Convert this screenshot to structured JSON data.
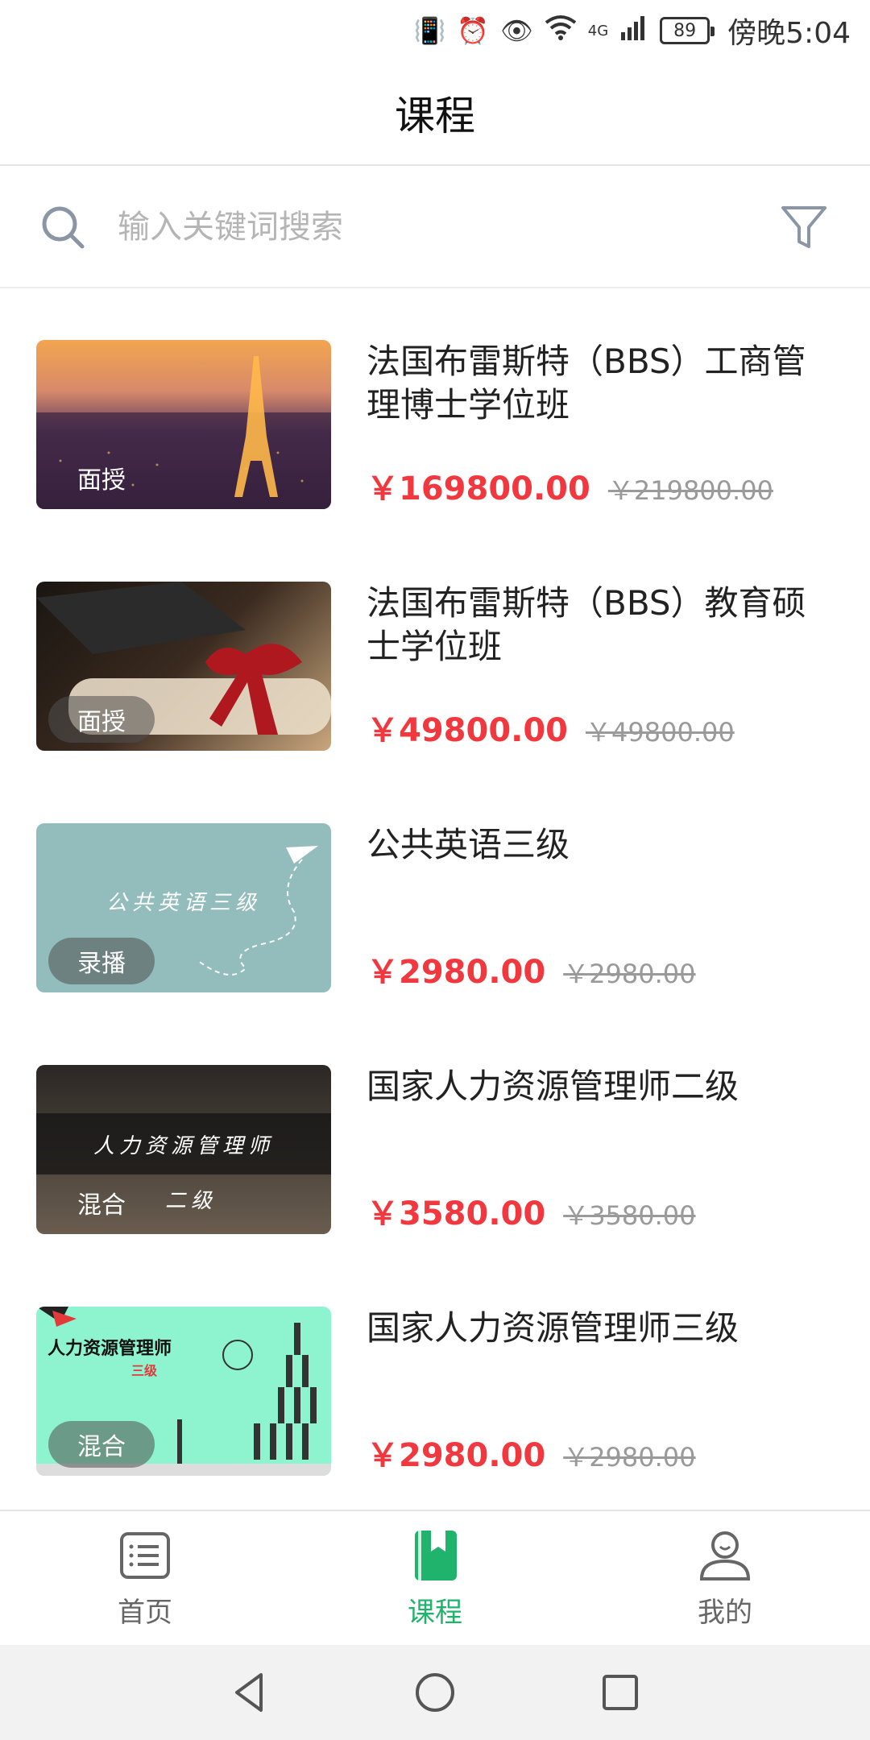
{
  "status_bar": {
    "battery": "89",
    "time": "傍晚5:04",
    "network": "4G"
  },
  "header": {
    "title": "课程"
  },
  "search": {
    "placeholder": "输入关键词搜索"
  },
  "colors": {
    "accent_green": "#1fb36b",
    "price_red": "#f2383f"
  },
  "courses": [
    {
      "title": "法国布雷斯特（BBS）工商管理博士学位班",
      "tag": "面授",
      "price": "￥169800.00",
      "original_price": "￥219800.00"
    },
    {
      "title": "法国布雷斯特（BBS）教育硕士学位班",
      "tag": "面授",
      "price": "￥49800.00",
      "original_price": "￥49800.00"
    },
    {
      "title": "公共英语三级",
      "tag": "录播",
      "price": "￥2980.00",
      "original_price": "￥2980.00",
      "thumb_text": "公共英语三级"
    },
    {
      "title": "国家人力资源管理师二级",
      "tag": "混合",
      "price": "￥3580.00",
      "original_price": "￥3580.00",
      "thumb_text": "人力资源管理师",
      "thumb_sub": "二级"
    },
    {
      "title": "国家人力资源管理师三级",
      "tag": "混合",
      "price": "￥2980.00",
      "original_price": "￥2980.00",
      "thumb_text": "人力资源管理师",
      "thumb_sub": "三级"
    }
  ],
  "tabs": [
    {
      "label": "首页",
      "icon": "list-icon"
    },
    {
      "label": "课程",
      "icon": "bookmark-book-icon",
      "active": true
    },
    {
      "label": "我的",
      "icon": "user-icon"
    }
  ]
}
